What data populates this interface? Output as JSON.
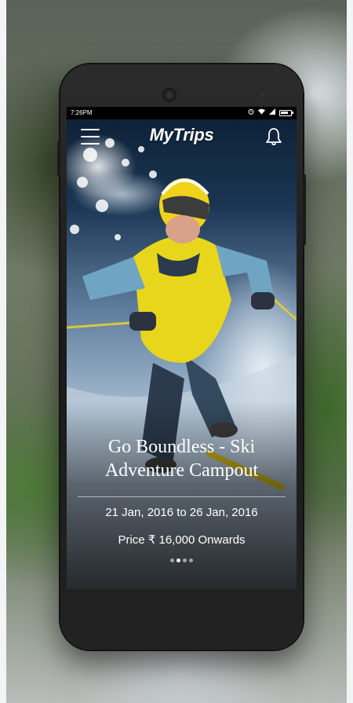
{
  "status_bar": {
    "time": "7:26PM",
    "icons": [
      "alarm-icon",
      "wifi-icon",
      "signal-icon",
      "battery-icon"
    ]
  },
  "app_bar": {
    "title": "MyTrips",
    "menu_icon": "hamburger-menu-icon",
    "notification_icon": "bell-icon"
  },
  "featured_trip": {
    "title": "Go Boundless - Ski Adventure Campout",
    "dates": "21 Jan, 2016 to 26 Jan, 2016",
    "price": "Price ₹ 16,000 Onwards"
  },
  "carousel": {
    "page_count": 4,
    "active_index": 1
  },
  "colors": {
    "text": "#ffffff",
    "status_bar_bg": "#000000",
    "phone_body": "#1e1e1e"
  }
}
